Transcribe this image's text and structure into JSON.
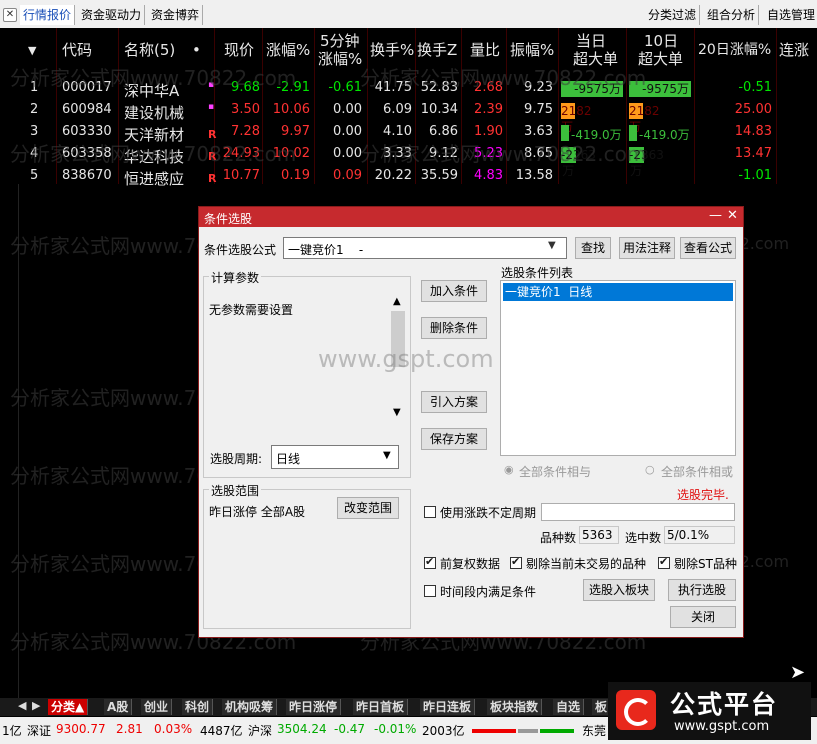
{
  "top_tabs": [
    "行情报价",
    "资金驱动力",
    "资金博弈"
  ],
  "top_right_tabs": [
    "分类过滤",
    "组合分析",
    "自选管理"
  ],
  "table": {
    "headers": {
      "code": "代码",
      "name": "名称(5)",
      "dot": "•",
      "price": "现价",
      "pct": "涨幅%",
      "pct5_l1": "5分钟",
      "pct5_l2": "涨幅%",
      "turnover": "换手%",
      "turnoverZ": "换手Z",
      "volratio": "量比",
      "amplitude": "振幅%",
      "today_l1": "当日",
      "today_l2": "超大单",
      "ten_l1": "10日",
      "ten_l2": "超大单",
      "pct20": "20日涨幅%",
      "lian": "连涨"
    },
    "rows": [
      {
        "idx": "1",
        "code": "000017",
        "name": "深中华A",
        "mark": "▪",
        "price": "9.68",
        "pct": "-2.91",
        "pct5": "-0.61",
        "turnover": "41.75",
        "turnoverZ": "52.83",
        "volratio": "2.68",
        "amplitude": "9.23",
        "today": "-9575万",
        "ten": "-9575万",
        "pct20": "-0.51"
      },
      {
        "idx": "2",
        "code": "600984",
        "name": "建设机械",
        "mark": "▪",
        "price": "3.50",
        "pct": "10.06",
        "pct5": "0.00",
        "turnover": "6.09",
        "turnoverZ": "10.34",
        "volratio": "2.39",
        "amplitude": "9.75",
        "today": "2182万",
        "ten": "2182万",
        "pct20": "25.00"
      },
      {
        "idx": "3",
        "code": "603330",
        "name": "天洋新材",
        "mark": "R",
        "price": "7.28",
        "pct": "9.97",
        "pct5": "0.00",
        "turnover": "4.10",
        "turnoverZ": "6.86",
        "volratio": "1.90",
        "amplitude": "3.63",
        "today": "-419.0万",
        "ten": "-419.0万",
        "pct20": "14.83"
      },
      {
        "idx": "4",
        "code": "603358",
        "name": "华达科技",
        "mark": "R",
        "price": "24.93",
        "pct": "10.02",
        "pct5": "0.00",
        "turnover": "3.33",
        "turnoverZ": "9.12",
        "volratio": "5.23",
        "amplitude": "8.65",
        "today": "-2363万",
        "ten": "-2363万",
        "pct20": "13.47"
      },
      {
        "idx": "5",
        "code": "838670",
        "name": "恒进感应",
        "mark": "R",
        "price": "10.77",
        "pct": "0.19",
        "pct5": "0.09",
        "turnover": "20.22",
        "turnoverZ": "35.59",
        "volratio": "4.83",
        "amplitude": "13.58",
        "today": "",
        "ten": "",
        "pct20": "-1.01"
      }
    ]
  },
  "watermarks": [
    "分析家公式网www.70822.com",
    "www.gspt.com"
  ],
  "dialog": {
    "title": "条件选股",
    "formula_label": "条件选股公式",
    "formula_value": "一键竞价1    -",
    "find_btn": "查找",
    "usage_btn": "用法注释",
    "view_btn": "查看公式",
    "params_group": "计算参数",
    "no_params": "无参数需要设置",
    "period_label": "选股周期:",
    "period_value": "日线",
    "range_group": "选股范围",
    "range_value": "昨日涨停 全部A股",
    "change_range_btn": "改变范围",
    "add_btn": "加入条件",
    "delete_btn": "删除条件",
    "import_btn": "引入方案",
    "save_btn": "保存方案",
    "list_label": "选股条件列表",
    "list_items": [
      "一键竞价1  日线"
    ],
    "radio_and": "全部条件相与",
    "radio_or": "全部条件相或",
    "done_text": "选股完毕.",
    "use_uncertain": "使用涨跌不定周期",
    "count_label": "品种数",
    "count_value": "5363",
    "selected_label": "选中数",
    "selected_value": "5/0.1%",
    "chk_restore": "前复权数据",
    "chk_exclude_untraded": "剔除当前未交易的品种",
    "chk_exclude_st": "剔除ST品种",
    "chk_period": "时间段内满足条件",
    "to_block_btn": "选股入板块",
    "exec_btn": "执行选股",
    "close_btn": "关闭"
  },
  "bottom_tabs": [
    "分类▲",
    "A股",
    "创业",
    "科创",
    "机构吸筹",
    "昨日涨停",
    "昨日首板",
    "昨日连板",
    "板块指数",
    "自选",
    "板"
  ],
  "status": {
    "s1": "1亿",
    "sz_label": "深证",
    "sz_value": "9300.77",
    "sz_change": "2.81",
    "sz_pct": "0.03%",
    "sz_amount": "4487亿",
    "hs_label": "沪深",
    "hs_value": "3504.24",
    "hs_change": "-0.47",
    "hs_pct": "-0.01%",
    "hs_amount": "2003亿",
    "right_text": "东莞"
  },
  "logo": {
    "text": "公式平台",
    "url": "www.gspt.com"
  },
  "colors": {
    "red": "#ff3232",
    "green": "#00e600",
    "dialog_title": "#c62a2e"
  }
}
